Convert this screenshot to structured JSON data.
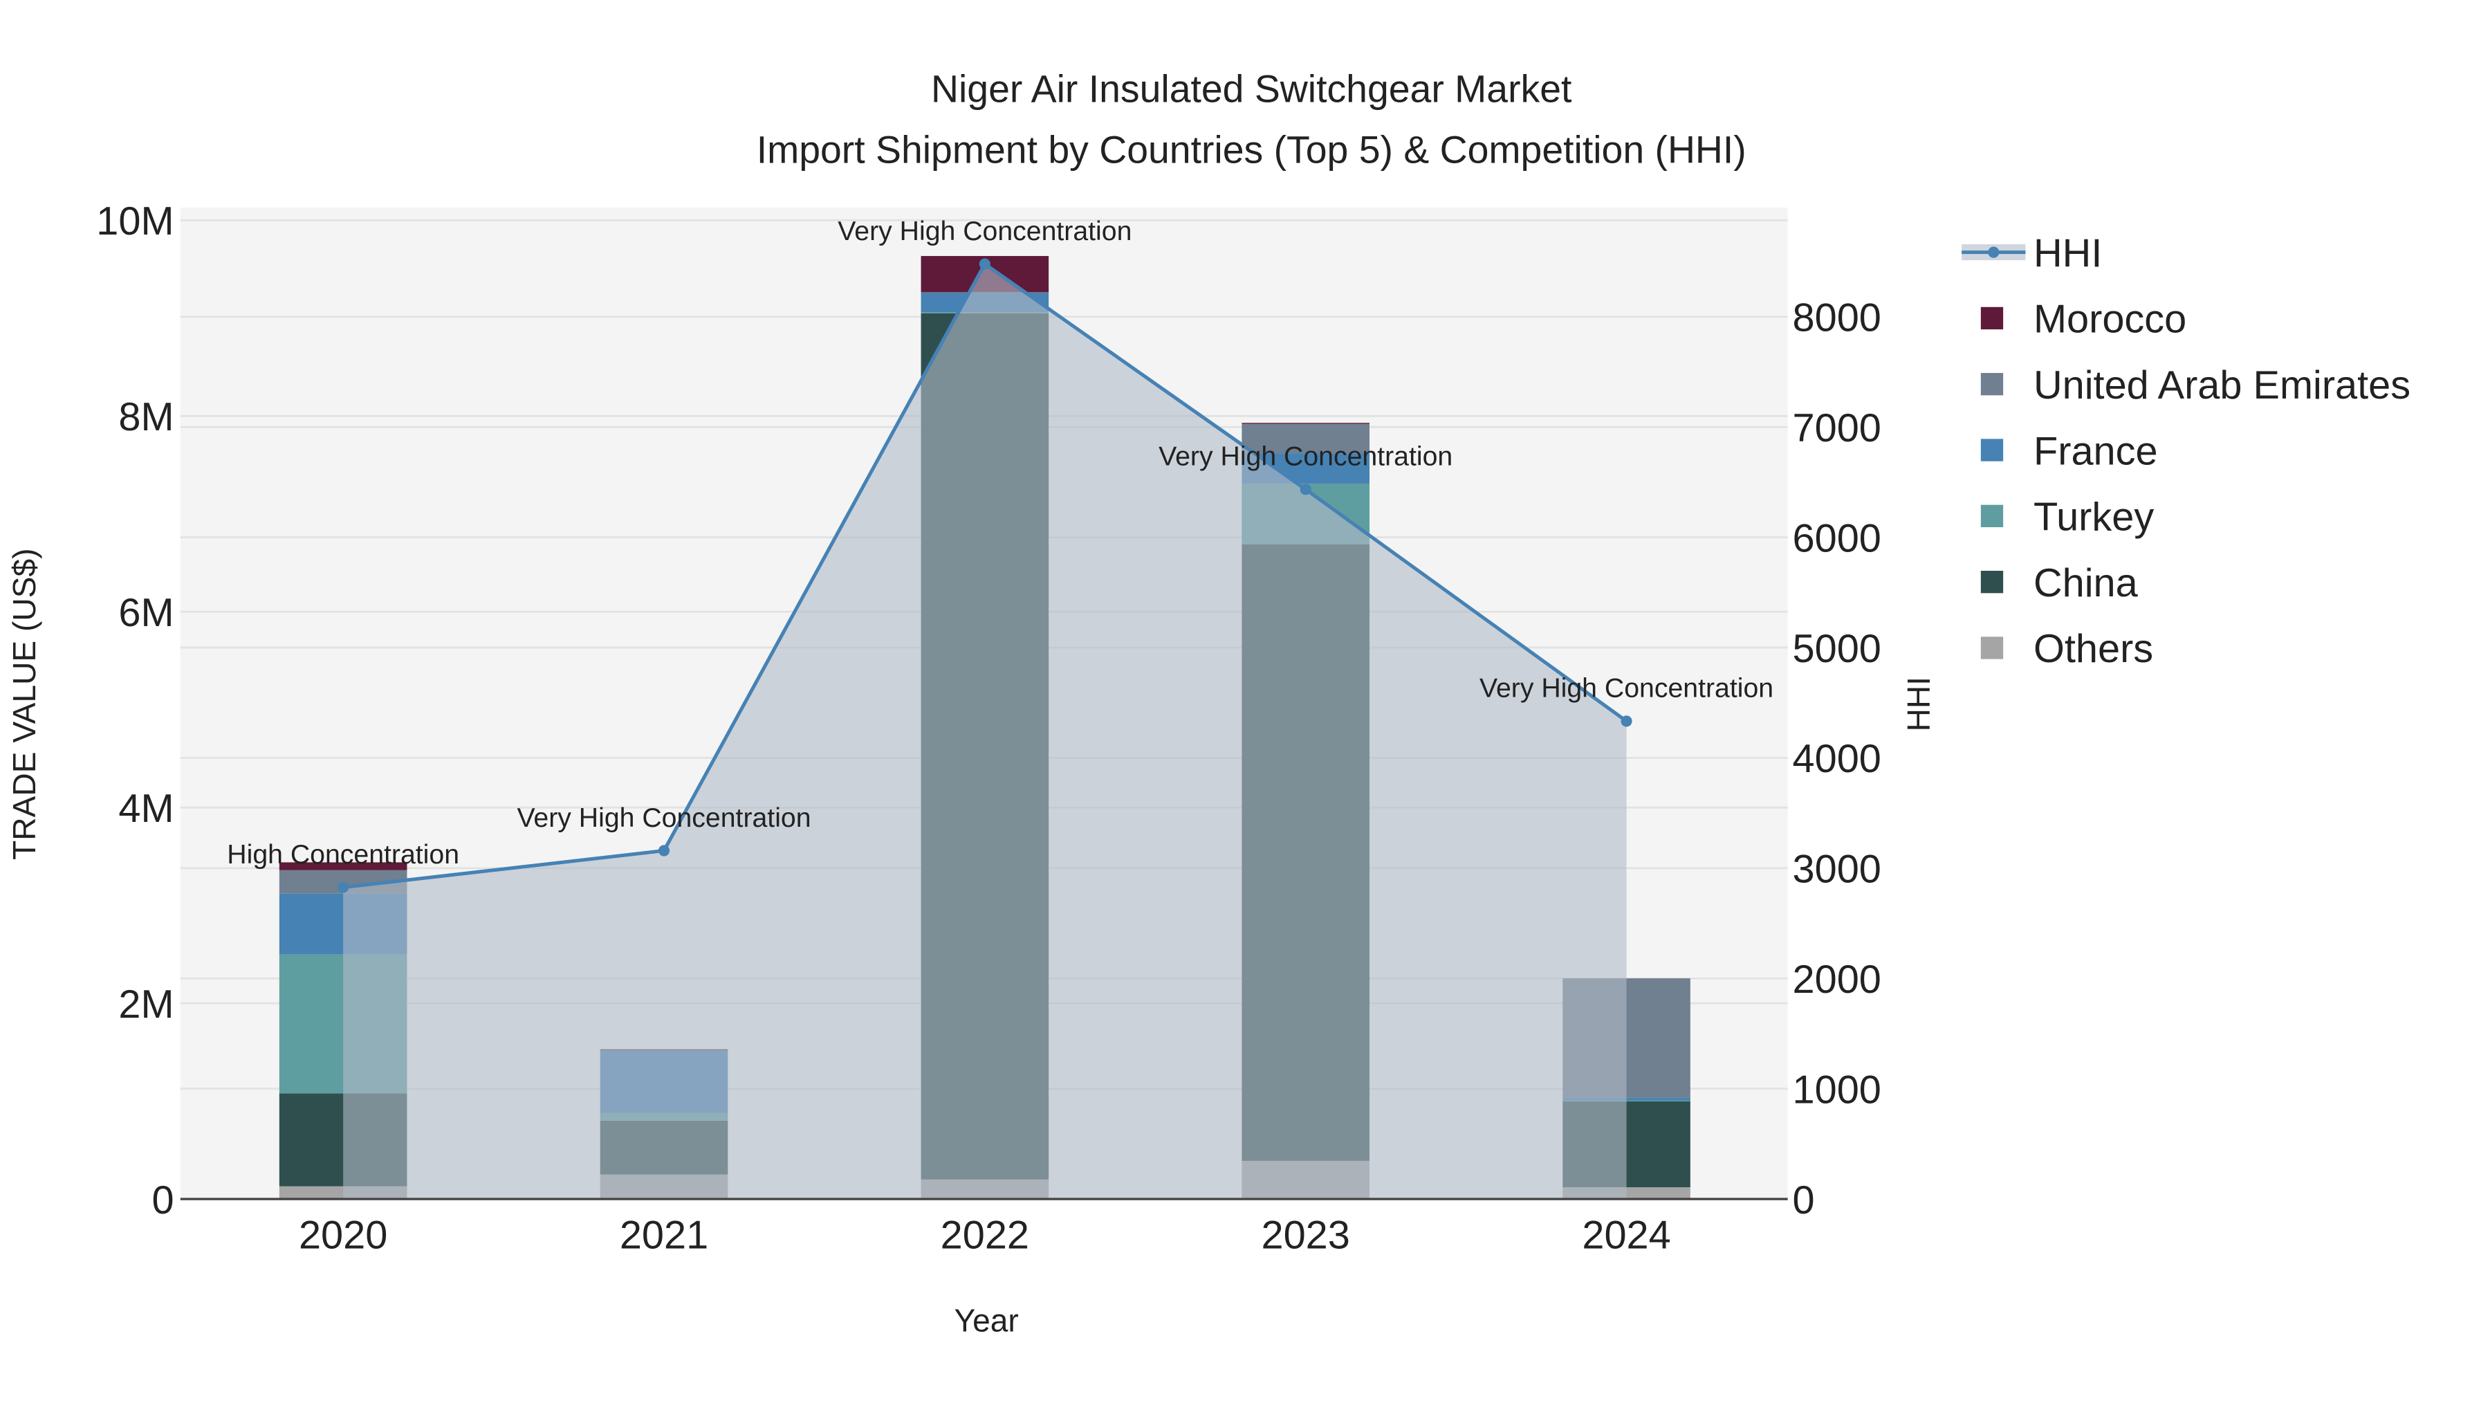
{
  "chart_data": {
    "type": "bar",
    "title": "Niger Air Insulated Switchgear Market",
    "subtitle": "Import Shipment by Countries (Top 5) & Competition (HHI)",
    "xlabel": "Year",
    "ylabel": "TRADE VALUE (US$)",
    "y2label": "HHI",
    "categories": [
      "2020",
      "2021",
      "2022",
      "2023",
      "2024"
    ],
    "ylim": [
      0,
      10130000
    ],
    "y2lim": [
      0,
      8990
    ],
    "yticks": [
      0,
      2000000,
      4000000,
      6000000,
      8000000,
      10000000
    ],
    "ytick_labels": [
      "0",
      "2M",
      "4M",
      "6M",
      "8M",
      "10M"
    ],
    "y2ticks": [
      0,
      1000,
      2000,
      3000,
      4000,
      5000,
      6000,
      7000,
      8000
    ],
    "y2tick_labels": [
      "0",
      "1000",
      "2000",
      "3000",
      "4000",
      "5000",
      "6000",
      "7000",
      "8000"
    ],
    "grid": true,
    "legend_position": "right",
    "series": [
      {
        "name": "Others",
        "color": "#a5a5a5",
        "values": [
          130000,
          250000,
          200000,
          390000,
          120000
        ]
      },
      {
        "name": "China",
        "color": "#2f4f4f",
        "values": [
          950000,
          550000,
          8850000,
          6300000,
          880000
        ]
      },
      {
        "name": "Turkey",
        "color": "#5f9ea0",
        "values": [
          1420000,
          80000,
          10000,
          620000,
          5000
        ]
      },
      {
        "name": "France",
        "color": "#4682b4",
        "values": [
          620000,
          640000,
          200000,
          310000,
          30000
        ]
      },
      {
        "name": "United Arab Emirates",
        "color": "#708090",
        "values": [
          240000,
          5000,
          5000,
          300000,
          1220000
        ]
      },
      {
        "name": "Morocco",
        "color": "#5f1a3a",
        "values": [
          80000,
          5000,
          370000,
          10000,
          0
        ]
      }
    ],
    "hhi": {
      "name": "HHI",
      "color": "#4682b4",
      "values": [
        2826,
        3159,
        8478,
        6435,
        4333
      ],
      "annotations": [
        "High Concentration",
        "Very High Concentration",
        "Very High Concentration",
        "Very High Concentration",
        "Very High Concentration"
      ]
    },
    "legend_order": [
      "HHI",
      "Morocco",
      "United Arab Emirates",
      "France",
      "Turkey",
      "China",
      "Others"
    ]
  }
}
